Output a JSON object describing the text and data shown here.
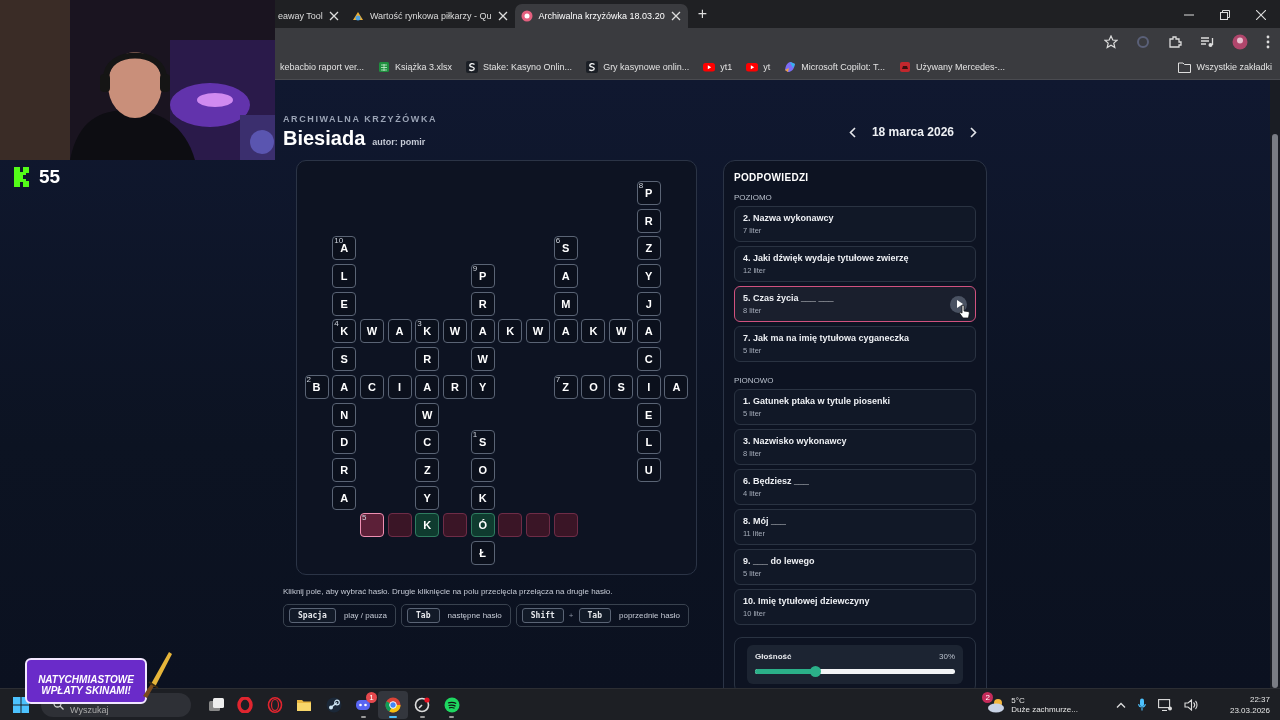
{
  "stream_overlay": {
    "viewer_count": "55",
    "promo": {
      "lines": [
        "NATYCHMIASTOWE",
        "WPŁATY SKINAMI!"
      ]
    }
  },
  "browser": {
    "tabs": [
      {
        "title": "eaway Tool",
        "kind": "plain",
        "selected": false
      },
      {
        "title": "Wartość rynkowa piłkarzy - Qu",
        "kind": "sticker",
        "selected": false
      },
      {
        "title": "Archiwalna krzyżówka 18.03.20",
        "kind": "badge",
        "selected": true
      }
    ],
    "new_tab": "+",
    "bookmarks": [
      {
        "title": "kebacbio raport ver...",
        "kind": "plain"
      },
      {
        "title": "Książka 3.xlsx",
        "kind": "sheet"
      },
      {
        "title": "Stake: Kasyno Onlin...",
        "kind": "letter"
      },
      {
        "title": "Gry kasynowe onlin...",
        "kind": "letter"
      },
      {
        "title": "yt1",
        "kind": "video"
      },
      {
        "title": "yt",
        "kind": "video"
      },
      {
        "title": "Microsoft Copilot: T...",
        "kind": "spark"
      },
      {
        "title": "Używany Mercedes-...",
        "kind": "car"
      }
    ],
    "all_bookmarks": "Wszystkie zakładki"
  },
  "page": {
    "kicker": "ARCHIWALNA KRZYŻÓWKA",
    "title": "Biesiada",
    "author": "autor: pomir",
    "date": "18 marca 2026",
    "grid": {
      "rows": [
        [
          null,
          null,
          null,
          null,
          null,
          null,
          null,
          null,
          null,
          null,
          null,
          null,
          {
            "letter": "P",
            "number": "8"
          },
          null
        ],
        [
          null,
          null,
          null,
          null,
          null,
          null,
          null,
          null,
          null,
          null,
          null,
          null,
          {
            "letter": "R"
          },
          null
        ],
        [
          null,
          {
            "letter": "A",
            "number": "10"
          },
          null,
          null,
          null,
          null,
          null,
          null,
          null,
          {
            "letter": "S",
            "number": "6"
          },
          null,
          null,
          {
            "letter": "Z"
          },
          null
        ],
        [
          null,
          {
            "letter": "L"
          },
          null,
          null,
          null,
          null,
          {
            "letter": "P",
            "number": "9"
          },
          null,
          null,
          {
            "letter": "A"
          },
          null,
          null,
          {
            "letter": "Y"
          },
          null
        ],
        [
          null,
          {
            "letter": "E"
          },
          null,
          null,
          null,
          null,
          {
            "letter": "R"
          },
          null,
          null,
          {
            "letter": "M"
          },
          null,
          null,
          {
            "letter": "J"
          },
          null
        ],
        [
          null,
          {
            "letter": "K",
            "number": "4"
          },
          {
            "letter": "W"
          },
          {
            "letter": "A"
          },
          {
            "letter": "K",
            "number": "3"
          },
          {
            "letter": "W"
          },
          {
            "letter": "A"
          },
          {
            "letter": "K"
          },
          {
            "letter": "W"
          },
          {
            "letter": "A"
          },
          {
            "letter": "K"
          },
          {
            "letter": "W"
          },
          {
            "letter": "A"
          },
          null
        ],
        [
          null,
          {
            "letter": "S"
          },
          null,
          null,
          {
            "letter": "R"
          },
          null,
          {
            "letter": "W"
          },
          null,
          null,
          null,
          null,
          null,
          {
            "letter": "C"
          },
          null
        ],
        [
          {
            "letter": "B",
            "number": "2"
          },
          {
            "letter": "A"
          },
          {
            "letter": "C"
          },
          {
            "letter": "I"
          },
          {
            "letter": "A"
          },
          {
            "letter": "R"
          },
          {
            "letter": "Y"
          },
          null,
          null,
          {
            "letter": "Z",
            "number": "7"
          },
          {
            "letter": "O"
          },
          {
            "letter": "S"
          },
          {
            "letter": "I"
          },
          {
            "letter": "A"
          }
        ],
        [
          null,
          {
            "letter": "N"
          },
          null,
          null,
          {
            "letter": "W"
          },
          null,
          null,
          null,
          null,
          null,
          null,
          null,
          {
            "letter": "E"
          },
          null
        ],
        [
          null,
          {
            "letter": "D"
          },
          null,
          null,
          {
            "letter": "C"
          },
          null,
          {
            "letter": "S",
            "number": "1"
          },
          null,
          null,
          null,
          null,
          null,
          {
            "letter": "L"
          },
          null
        ],
        [
          null,
          {
            "letter": "R"
          },
          null,
          null,
          {
            "letter": "Z"
          },
          null,
          {
            "letter": "O"
          },
          null,
          null,
          null,
          null,
          null,
          {
            "letter": "U"
          },
          null
        ],
        [
          null,
          {
            "letter": "A"
          },
          null,
          null,
          {
            "letter": "Y"
          },
          null,
          {
            "letter": "K"
          },
          null,
          null,
          null,
          null,
          null,
          null,
          null
        ],
        [
          null,
          null,
          {
            "number": "5",
            "kind": "active"
          },
          {
            "kind": "word"
          },
          {
            "letter": "K",
            "kind": "found"
          },
          {
            "kind": "word"
          },
          {
            "letter": "Ó",
            "kind": "found"
          },
          {
            "kind": "word"
          },
          {
            "kind": "word"
          },
          {
            "kind": "word"
          },
          null,
          null,
          null,
          null
        ],
        [
          null,
          null,
          null,
          null,
          null,
          null,
          {
            "letter": "Ł"
          },
          null,
          null,
          null,
          null,
          null,
          null,
          null
        ]
      ]
    },
    "instructions": "Kliknij pole, aby wybrać hasło. Drugie kliknięcie na polu przecięcia przełącza na drugie hasło.",
    "shortcuts": [
      {
        "keys": [
          "Spacja"
        ],
        "label": "play / pauza"
      },
      {
        "keys": [
          "Tab"
        ],
        "label": "następne hasło"
      },
      {
        "keys": [
          "Shift",
          "Tab"
        ],
        "joiner": "+",
        "label": "poprzednie hasło"
      }
    ],
    "clues": {
      "title": "PODPOWIEDZI",
      "sections": [
        {
          "heading": "POZIOMO",
          "items": [
            {
              "text": "2. Nazwa wykonawcy",
              "length": "7 liter",
              "selected": false
            },
            {
              "text": "4. Jaki dźwięk wydaje tytułowe zwierzę",
              "length": "12 liter",
              "selected": false
            },
            {
              "text": "5. Czas życia ___ ___",
              "length": "8 liter",
              "selected": true
            },
            {
              "text": "7. Jak ma na imię tytułowa cyganeczka",
              "length": "5 liter",
              "selected": false
            }
          ]
        },
        {
          "heading": "PIONOWO",
          "items": [
            {
              "text": "1. Gatunek ptaka w tytule piosenki",
              "length": "5 liter",
              "selected": false
            },
            {
              "text": "3. Nazwisko wykonawcy",
              "length": "8 liter",
              "selected": false
            },
            {
              "text": "6. Będziesz ___",
              "length": "4 liter",
              "selected": false
            },
            {
              "text": "8. Mój ___",
              "length": "11 liter",
              "selected": false
            },
            {
              "text": "9. ___ do lewego",
              "length": "5 liter",
              "selected": false
            },
            {
              "text": "10. Imię tytułowej dziewczyny",
              "length": "10 liter",
              "selected": false
            }
          ]
        }
      ]
    },
    "volume": {
      "label": "Głośność",
      "reading": "30%",
      "level": 0.3
    }
  },
  "taskbar": {
    "search": "Wyszukaj",
    "apps": [
      {
        "kind": "taskview",
        "running": false,
        "selected": false
      },
      {
        "kind": "ring",
        "running": false,
        "selected": false
      },
      {
        "kind": "thin-ring",
        "running": false,
        "selected": false
      },
      {
        "kind": "folder",
        "running": false,
        "selected": false
      },
      {
        "kind": "lever",
        "running": false,
        "selected": false
      },
      {
        "kind": "controller",
        "badge": "1",
        "running": true,
        "selected": false
      },
      {
        "kind": "segmented",
        "running": true,
        "selected": true
      },
      {
        "kind": "dial",
        "running": true,
        "selected": false
      },
      {
        "kind": "waves",
        "running": true,
        "selected": false
      }
    ],
    "weather": {
      "badge": "2",
      "temperature": "5°C",
      "condition": "Duże zachmurze..."
    },
    "time": "22:37",
    "date": "23.03.2026"
  }
}
